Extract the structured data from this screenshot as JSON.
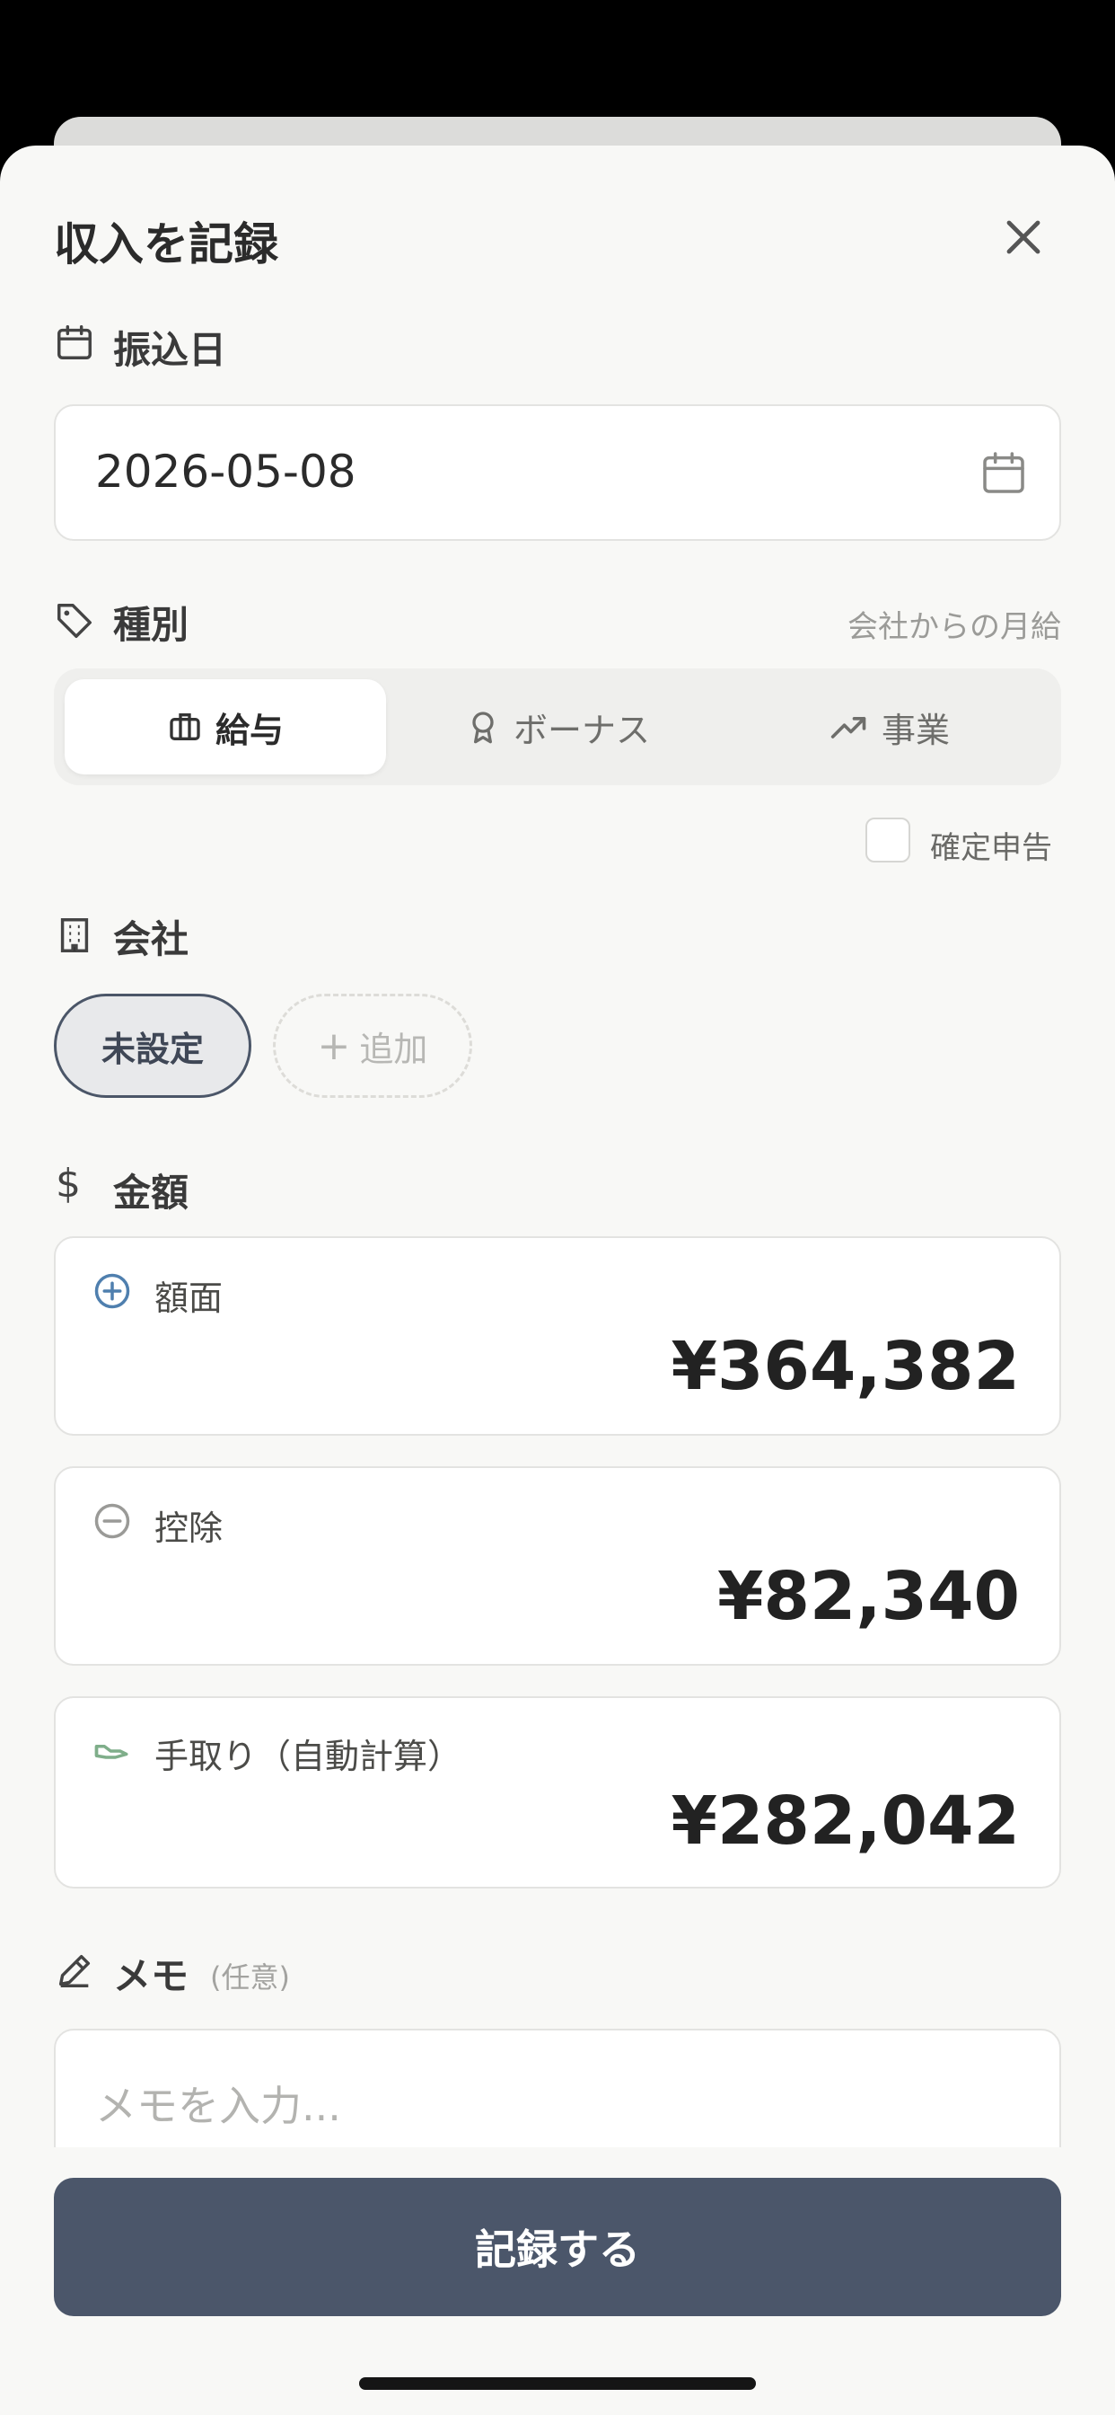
{
  "sheet": {
    "title": "収入を記録",
    "close_icon": "close-icon"
  },
  "date_section": {
    "label": "振込日",
    "value": "2026-05-08",
    "icon": "calendar-icon"
  },
  "type_section": {
    "label": "種別",
    "hint": "会社からの月給",
    "icon": "tag-icon",
    "options": [
      {
        "label": "給与",
        "icon": "briefcase-icon",
        "selected": true
      },
      {
        "label": "ボーナス",
        "icon": "award-icon",
        "selected": false
      },
      {
        "label": "事業",
        "icon": "trending-up-icon",
        "selected": false
      }
    ],
    "tax_return_label": "確定申告",
    "tax_return_checked": false
  },
  "company_section": {
    "label": "会社",
    "icon": "building-icon",
    "selected_chip": "未設定",
    "add_label": "追加"
  },
  "amount_section": {
    "label": "金額",
    "icon": "dollar-icon",
    "gross": {
      "label": "額面",
      "value": "¥364,382",
      "icon": "plus-circle-icon"
    },
    "deduction": {
      "label": "控除",
      "value": "¥82,340",
      "icon": "minus-circle-icon"
    },
    "net": {
      "label": "手取り（自動計算）",
      "value": "¥282,042",
      "icon": "hand-money-icon"
    }
  },
  "memo_section": {
    "label": "メモ",
    "optional": "(任意)",
    "icon": "pencil-icon",
    "placeholder": "メモを入力..."
  },
  "submit_label": "記録する",
  "colors": {
    "accent": "#4b566a",
    "background": "#f8f8f6",
    "gross_icon": "#4f7fae",
    "net_icon": "#7fae8a"
  }
}
